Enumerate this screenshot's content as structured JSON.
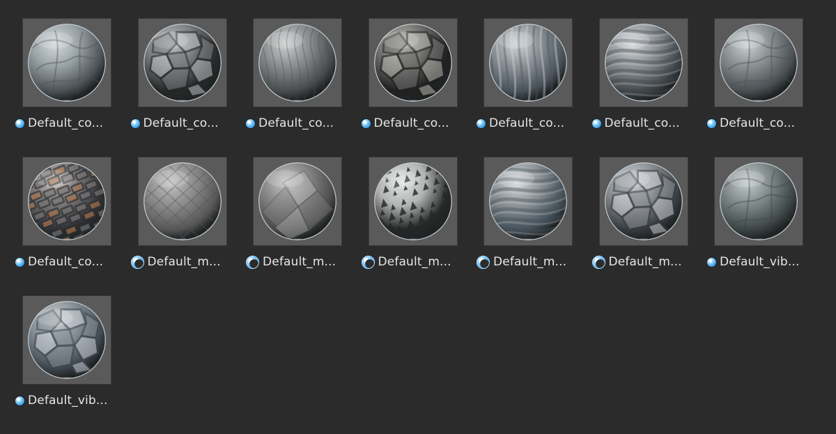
{
  "assets": [
    {
      "label": "Default_co...",
      "icon": "material-icon",
      "icon_variant": "small",
      "swatch": {
        "base": "#9aa3a8",
        "light": "#d8dde0",
        "dark": "#4d5357",
        "accent": "#7f929b",
        "pattern": "rock"
      }
    },
    {
      "label": "Default_co...",
      "icon": "material-icon",
      "icon_variant": "small",
      "swatch": {
        "base": "#7a7d80",
        "light": "#c4c7c8",
        "dark": "#262829",
        "accent": "#5e6264",
        "pattern": "flagstones"
      }
    },
    {
      "label": "Default_co...",
      "icon": "material-icon",
      "icon_variant": "small",
      "swatch": {
        "base": "#8a8d8f",
        "light": "#d0d2d2",
        "dark": "#4a4d4f",
        "accent": "#6d7275",
        "pattern": "feather"
      }
    },
    {
      "label": "Default_co...",
      "icon": "material-icon",
      "icon_variant": "small",
      "swatch": {
        "base": "#6f706e",
        "light": "#bdbcb6",
        "dark": "#202020",
        "accent": "#7a6a59",
        "pattern": "flagstones"
      }
    },
    {
      "label": "Default_co...",
      "icon": "material-icon",
      "icon_variant": "small",
      "swatch": {
        "base": "#8a9096",
        "light": "#d3d8dc",
        "dark": "#4b535b",
        "accent": "#6f8190",
        "pattern": "stripes"
      }
    },
    {
      "label": "Default_co...",
      "icon": "material-icon",
      "icon_variant": "small",
      "swatch": {
        "base": "#8f9498",
        "light": "#d7dadd",
        "dark": "#454a4e",
        "accent": "#737c82",
        "pattern": "diagonal"
      }
    },
    {
      "label": "Default_co...",
      "icon": "material-icon",
      "icon_variant": "small",
      "swatch": {
        "base": "#8a9092",
        "light": "#d1d6d8",
        "dark": "#4a5053",
        "accent": "#6d8790",
        "pattern": "rock"
      }
    },
    {
      "label": "Default_co...",
      "icon": "material-icon",
      "icon_variant": "small",
      "swatch": {
        "base": "#787575",
        "light": "#c8c1bb",
        "dark": "#2f3134",
        "accent": "#b0764c",
        "pattern": "brick"
      }
    },
    {
      "label": "Default_m...",
      "icon": "material-icon",
      "icon_variant": "large",
      "swatch": {
        "base": "#8d8d8d",
        "light": "#c7c7c7",
        "dark": "#585858",
        "accent": "#777777",
        "pattern": "tiles"
      }
    },
    {
      "label": "Default_m...",
      "icon": "material-icon",
      "icon_variant": "large",
      "swatch": {
        "base": "#858585",
        "light": "#c9c9c9",
        "dark": "#4b4b4b",
        "accent": "#6a6a6a",
        "pattern": "shards"
      }
    },
    {
      "label": "Default_m...",
      "icon": "material-icon",
      "icon_variant": "large",
      "swatch": {
        "base": "#b3b5b5",
        "light": "#e5e6e6",
        "dark": "#262727",
        "accent": "#7f8383",
        "pattern": "terrazzo"
      }
    },
    {
      "label": "Default_m...",
      "icon": "material-icon",
      "icon_variant": "large",
      "swatch": {
        "base": "#8d9499",
        "light": "#d7dbde",
        "dark": "#46525b",
        "accent": "#6f8392",
        "pattern": "diagonal"
      }
    },
    {
      "label": "Default_m...",
      "icon": "material-icon",
      "icon_variant": "large",
      "swatch": {
        "base": "#8c9196",
        "light": "#d2d6d9",
        "dark": "#373c40",
        "accent": "#697780",
        "pattern": "flagstones"
      }
    },
    {
      "label": "Default_vib...",
      "icon": "material-icon",
      "icon_variant": "small",
      "swatch": {
        "base": "#7f8889",
        "light": "#c8d0d1",
        "dark": "#3d4546",
        "accent": "#5d7d89",
        "pattern": "rock"
      }
    },
    {
      "label": "Default_vib...",
      "icon": "material-icon",
      "icon_variant": "small",
      "swatch": {
        "base": "#879097",
        "light": "#d2d8dc",
        "dark": "#3f4850",
        "accent": "#6f8fa2",
        "pattern": "flagstones"
      }
    }
  ]
}
